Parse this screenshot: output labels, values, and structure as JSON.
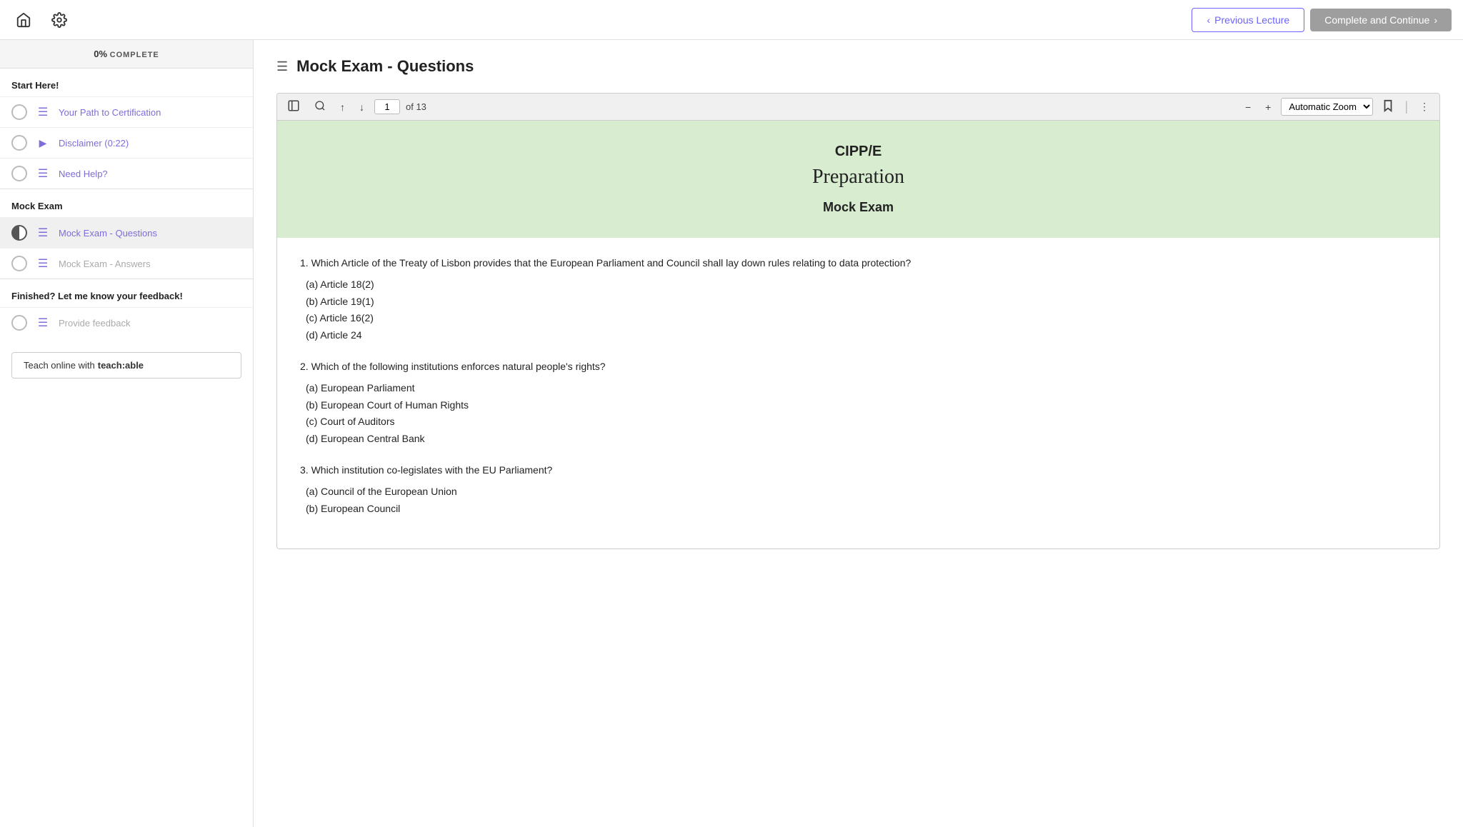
{
  "topNav": {
    "prevLectureLabel": "Previous Lecture",
    "completeContinueLabel": "Complete and Continue"
  },
  "progressBar": {
    "percent": "0%",
    "label": "COMPLETE"
  },
  "sidebar": {
    "sections": [
      {
        "title": "Start Here!",
        "items": [
          {
            "id": "path-cert",
            "label": "Your Path to Certification",
            "iconType": "lines",
            "circleType": "empty",
            "grayLabel": false
          },
          {
            "id": "disclaimer",
            "label": "Disclaimer (0:22)",
            "iconType": "video",
            "circleType": "empty",
            "grayLabel": false
          },
          {
            "id": "need-help",
            "label": "Need Help?",
            "iconType": "lines",
            "circleType": "empty",
            "grayLabel": false
          }
        ]
      },
      {
        "title": "Mock Exam",
        "items": [
          {
            "id": "mock-questions",
            "label": "Mock Exam - Questions",
            "iconType": "lines",
            "circleType": "half",
            "grayLabel": false,
            "active": true
          },
          {
            "id": "mock-answers",
            "label": "Mock Exam - Answers",
            "iconType": "lines",
            "circleType": "empty",
            "grayLabel": true
          }
        ]
      },
      {
        "title": "Finished? Let me know your feedback!",
        "items": [
          {
            "id": "feedback",
            "label": "Provide feedback",
            "iconType": "lines",
            "circleType": "empty",
            "grayLabel": true
          }
        ]
      }
    ],
    "teachableLabel": "Teach online with ",
    "teachableBrand": "teach:able"
  },
  "contentTitle": "Mock Exam - Questions",
  "pdf": {
    "currentPage": "1",
    "totalPages": "of 13",
    "zoomLabel": "Automatic Zoom",
    "headerTitle": "CIPP/E",
    "headerScript": "Preparation",
    "headerSubtitle": "Mock Exam",
    "questions": [
      {
        "number": "1",
        "text": "Which Article of the Treaty of Lisbon provides that the European Parliament and Council shall lay down rules relating to data protection?",
        "options": [
          "(a)  Article 18(2)",
          "(b)  Article 19(1)",
          "(c)  Article 16(2)",
          "(d)  Article 24"
        ]
      },
      {
        "number": "2",
        "text": "Which of the following institutions enforces natural people's rights?",
        "options": [
          "(a)  European Parliament",
          "(b)  European Court of Human Rights",
          "(c)  Court of Auditors",
          "(d)  European Central Bank"
        ]
      },
      {
        "number": "3",
        "text": "Which institution co-legislates with the EU Parliament?",
        "options": [
          "(a)  Council of the European Union",
          "(b)  European Council"
        ]
      }
    ]
  }
}
